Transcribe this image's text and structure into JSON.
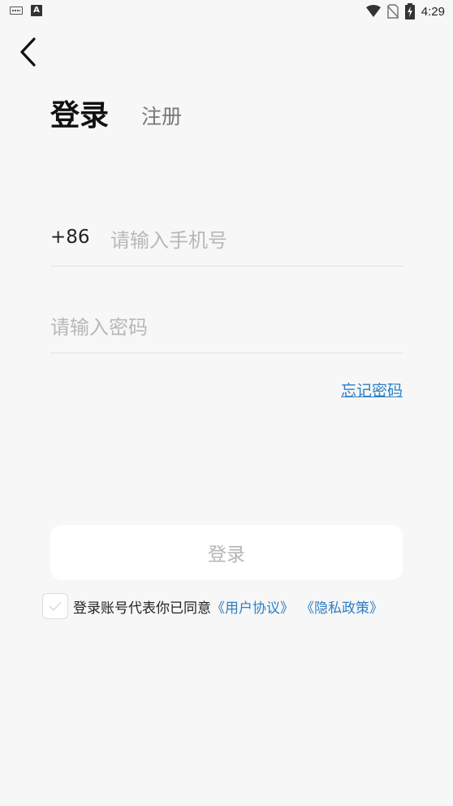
{
  "status_bar": {
    "time": "4:29",
    "left_icons": [
      "keyboard-icon",
      "a-notification-icon"
    ],
    "right_icons": [
      "wifi-icon",
      "no-sim-icon",
      "battery-charging-icon"
    ]
  },
  "nav": {
    "back_icon": "chevron-left-icon"
  },
  "tabs": {
    "login": "登录",
    "register": "注册"
  },
  "phone": {
    "prefix": "+86",
    "placeholder": "请输入手机号",
    "value": ""
  },
  "password": {
    "placeholder": "请输入密码",
    "value": ""
  },
  "forgot_password": "忘记密码",
  "login_button": "登录",
  "agreement": {
    "checked": false,
    "text": "登录账号代表你已同意",
    "user_agreement": "《用户协议》",
    "privacy_policy": "《隐私政策》"
  },
  "colors": {
    "background": "#f7f7f7",
    "link": "#2b7fc7",
    "button_bg": "#ffffff",
    "button_text_disabled": "#b5b5b5",
    "placeholder": "#b8b8b8"
  }
}
